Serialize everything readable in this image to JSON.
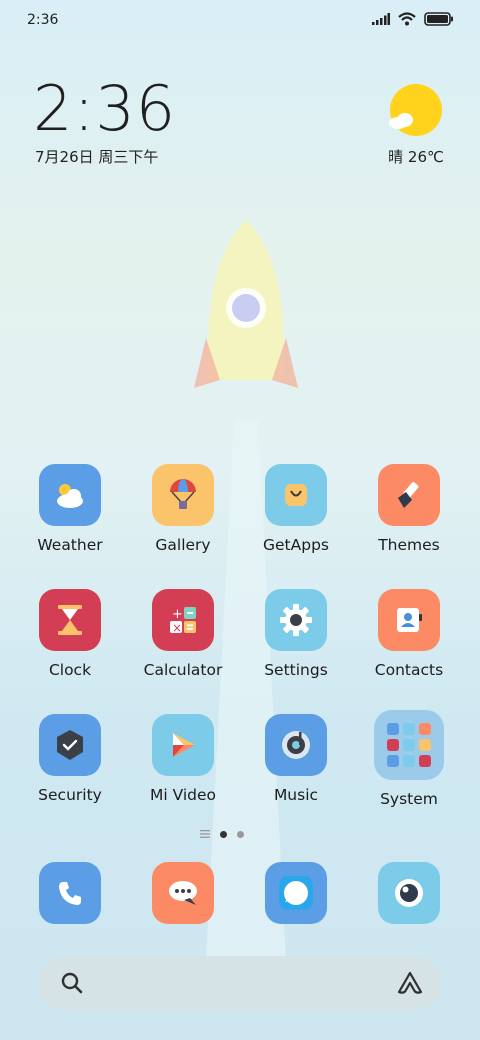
{
  "status_bar": {
    "time": "2:36",
    "icons": [
      "signal-icon",
      "wifi-icon",
      "battery-icon"
    ]
  },
  "clock_widget": {
    "time": "2:36",
    "date": "7月26日 周三下午"
  },
  "weather_widget": {
    "condition_icon": "sunny-cloud-icon",
    "text": "晴 26℃"
  },
  "apps": [
    {
      "label": "Weather",
      "icon": "weather-icon",
      "color": "#5b9ee6"
    },
    {
      "label": "Gallery",
      "icon": "gallery-icon",
      "color": "#fcc46a"
    },
    {
      "label": "GetApps",
      "icon": "getapps-icon",
      "color": "#7ccbe8"
    },
    {
      "label": "Themes",
      "icon": "themes-icon",
      "color": "#fb8a65"
    },
    {
      "label": "Clock",
      "icon": "clock-icon",
      "color": "#d33e55"
    },
    {
      "label": "Calculator",
      "icon": "calculator-icon",
      "color": "#d33e55"
    },
    {
      "label": "Settings",
      "icon": "settings-icon",
      "color": "#7ccbe8"
    },
    {
      "label": "Contacts",
      "icon": "contacts-icon",
      "color": "#fb8a65"
    },
    {
      "label": "Security",
      "icon": "security-icon",
      "color": "#5b9ee6"
    },
    {
      "label": "Mi Video",
      "icon": "mi-video-icon",
      "color": "#7ccbe8"
    },
    {
      "label": "Music",
      "icon": "music-icon",
      "color": "#5b9ee6"
    },
    {
      "label": "System",
      "icon": "folder-icon",
      "color": "#9ccbea"
    }
  ],
  "page_indicator": {
    "pages": 2,
    "active": 0
  },
  "dock": [
    {
      "icon": "phone-icon",
      "color": "#5b9ee6"
    },
    {
      "icon": "messages-icon",
      "color": "#fb8a65"
    },
    {
      "icon": "browser-icon",
      "color": "#5b9ee6"
    },
    {
      "icon": "camera-icon",
      "color": "#7ccbe8"
    }
  ],
  "search_bar": {
    "left_icon": "search-icon",
    "right_icon": "assistant-icon"
  }
}
